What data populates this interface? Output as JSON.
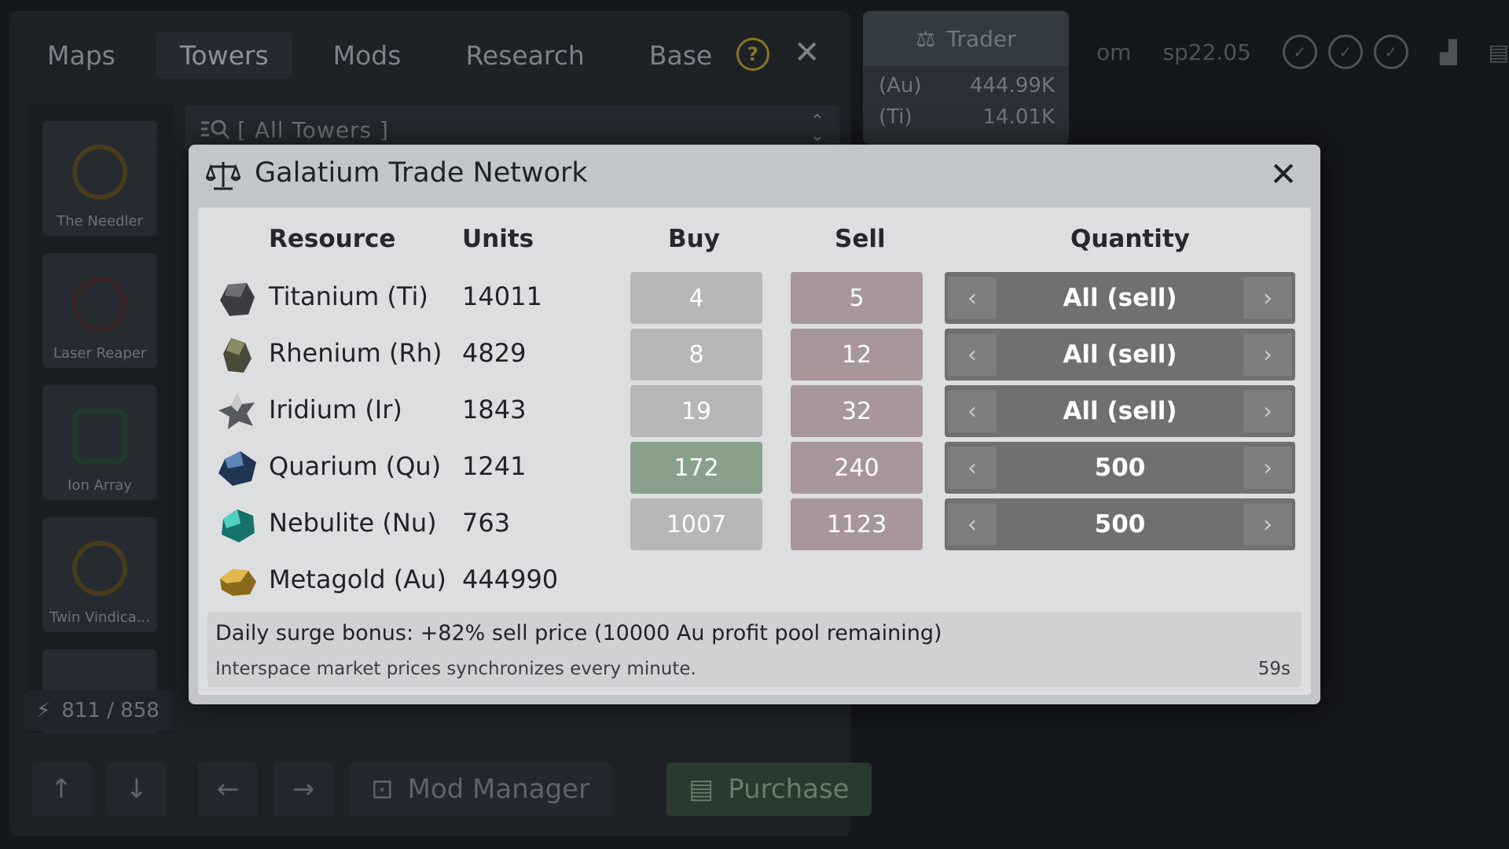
{
  "tabs": [
    "Maps",
    "Towers",
    "Mods",
    "Research",
    "Base"
  ],
  "search": {
    "placeholder": "[ All Towers ]"
  },
  "towers": [
    "The Needler",
    "Laser Reaper",
    "Ion Array",
    "Twin Vindica..."
  ],
  "energy": "811 / 858",
  "bottom": {
    "mod_manager": "Mod Manager",
    "purchase": "Purchase"
  },
  "trader": {
    "title": "Trader",
    "rows": [
      {
        "code": "(Au)",
        "value": "444.99K"
      },
      {
        "code": "(Ti)",
        "value": "14.01K"
      }
    ]
  },
  "status": {
    "partial": "om",
    "version": "sp22.05"
  },
  "modal": {
    "title": "Galatium Trade Network",
    "headers": {
      "resource": "Resource",
      "units": "Units",
      "buy": "Buy",
      "sell": "Sell",
      "quantity": "Quantity"
    },
    "rows": [
      {
        "name": "Titanium (Ti)",
        "units": "14011",
        "buy": "4",
        "sell": "5",
        "qty": "All (sell)"
      },
      {
        "name": "Rhenium (Rh)",
        "units": "4829",
        "buy": "8",
        "sell": "12",
        "qty": "All (sell)"
      },
      {
        "name": "Iridium (Ir)",
        "units": "1843",
        "buy": "19",
        "sell": "32",
        "qty": "All (sell)"
      },
      {
        "name": "Quarium (Qu)",
        "units": "1241",
        "buy": "172",
        "sell": "240",
        "qty": "500"
      },
      {
        "name": "Nebulite (Nu)",
        "units": "763",
        "buy": "1007",
        "sell": "1123",
        "qty": "500"
      },
      {
        "name": "Metagold (Au)",
        "units": "444990"
      }
    ],
    "surge": "Daily surge bonus: +82% sell price (10000 Au profit pool remaining)",
    "sync": "Interspace market prices synchronizes every minute.",
    "timer": "59s"
  },
  "colors": {
    "buy_highlight": "#8aa08b",
    "sell": "#a8979a",
    "buy": "#b5b7b9"
  },
  "icons": [
    "help-icon",
    "close-icon",
    "search-icon",
    "scale-icon",
    "chevron-left-icon",
    "chevron-right-icon",
    "bolt-icon"
  ]
}
